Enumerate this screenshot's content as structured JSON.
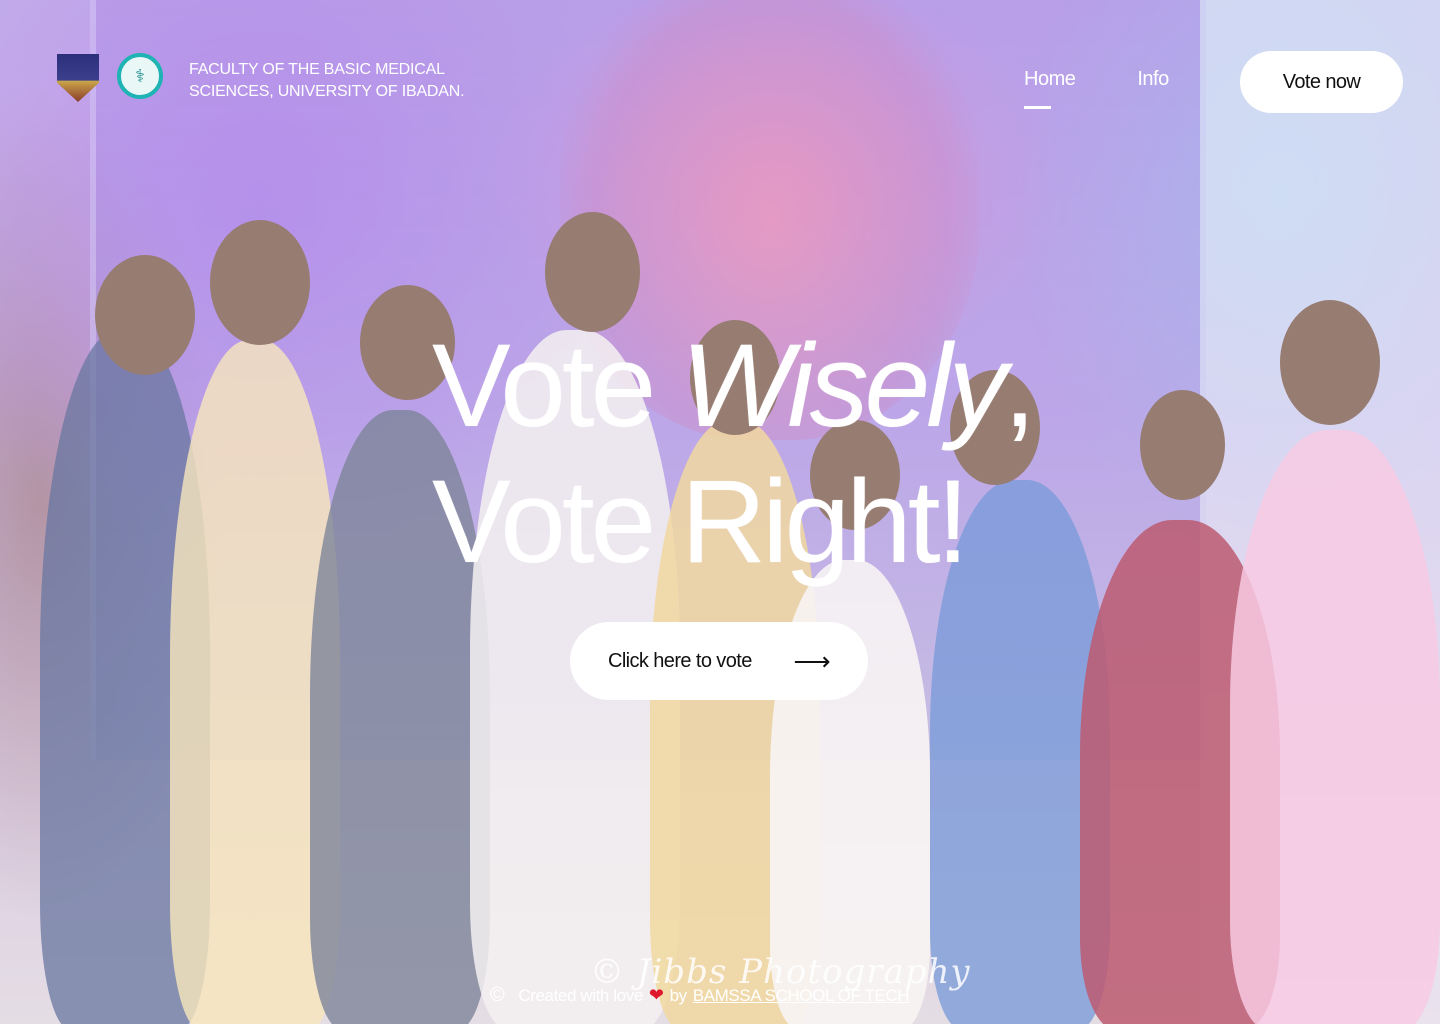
{
  "header": {
    "faculty_line1": "FACULTY OF THE BASIC MEDICAL",
    "faculty_line2": "SCIENCES, UNIVERSITY OF IBADAN.",
    "nav": [
      {
        "label": "Home",
        "active": true
      },
      {
        "label": "Info",
        "active": false
      }
    ],
    "vote_now_label": "Vote now"
  },
  "hero": {
    "line1_a": "Vote ",
    "line1_b": "Wisely",
    "line1_c": ",",
    "line2": "Vote Right!",
    "cta_label": "Click here to vote",
    "cta_arrow": "⟶"
  },
  "footer": {
    "copyright_symbol": "©",
    "created_text": "Created with love",
    "heart": "❤",
    "by_text": "by",
    "link_text": "BAMSSA SCHOOL OF TECH"
  },
  "photo": {
    "watermark": "© Jibbs Photography"
  },
  "colors": {
    "text": "#ffffff",
    "button_bg": "#ffffff",
    "button_text": "#111111",
    "heart": "#e0182d",
    "logo_teal": "#1fb3b3"
  },
  "icons": [
    "logo-crest-icon",
    "logo-bamssa-icon",
    "arrow-right-icon",
    "copyright-icon",
    "heart-icon"
  ]
}
